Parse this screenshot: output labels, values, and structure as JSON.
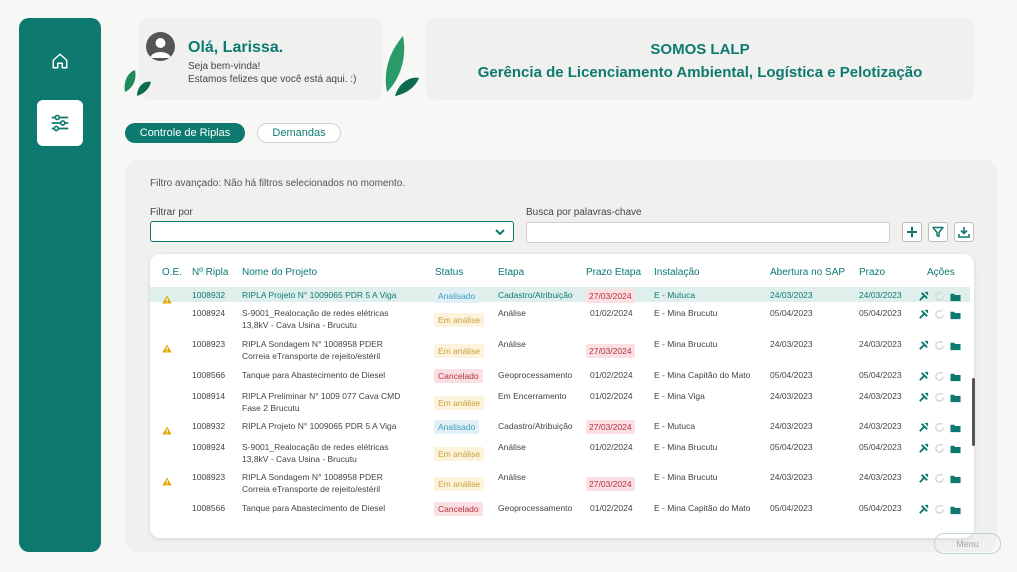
{
  "greeting": {
    "title": "Olá, Larissa.",
    "line1": "Seja bem-vinda!",
    "line2": "Estamos felizes que você está aqui. :)"
  },
  "banner": {
    "title": "SOMOS LALP",
    "subtitle": "Gerência de Licenciamento Ambiental, Logística e Pelotização"
  },
  "tabs": [
    "Controle de Riplas",
    "Demandas"
  ],
  "filter": {
    "info": "Filtro avançado: Não há filtros selecionados no momento.",
    "filter_label": "Filtrar por",
    "search_label": "Busca por palavras-chave",
    "filter_value": "",
    "search_value": ""
  },
  "table": {
    "headers": [
      "O.E.",
      "Nº Ripla",
      "Nome do Projeto",
      "Status",
      "Etapa",
      "Prazo Etapa",
      "Instalação",
      "Abertura no SAP",
      "Prazo",
      "Ações"
    ],
    "rows": [
      {
        "warn": true,
        "id": "1008932",
        "name1": "RIPLA Projeto N° 1009065 PDR 5 A Viga",
        "name2": "",
        "status": "Analisado",
        "etapa": "Cadastro/Atribuição",
        "prazo_etapa": "27/03/2024",
        "prazo_etapa_late": true,
        "instalacao": "E - Mutuca",
        "abertura": "24/03/2023",
        "prazo": "24/03/2023",
        "highlight": true
      },
      {
        "warn": false,
        "id": "1008924",
        "name1": "S-9001_Realocação de redes elétricas",
        "name2": "13,8kV - Cava Usina - Brucutu",
        "status": "Em análise",
        "etapa": "Análise",
        "prazo_etapa": "01/02/2024",
        "prazo_etapa_late": false,
        "instalacao": "E - Mina Brucutu",
        "abertura": "05/04/2023",
        "prazo": "05/04/2023",
        "highlight": false
      },
      {
        "warn": true,
        "id": "1008923",
        "name1": "RIPLA Sondagem N° 1008958 PDER",
        "name2": "Correia eTransporte de rejeito/estéril",
        "status": "Em análise",
        "etapa": "Análise",
        "prazo_etapa": "27/03/2024",
        "prazo_etapa_late": true,
        "instalacao": "E - Mina Brucutu",
        "abertura": "24/03/2023",
        "prazo": "24/03/2023",
        "highlight": false
      },
      {
        "warn": false,
        "id": "1008566",
        "name1": "Tanque para Abastecimento de Diesel",
        "name2": "",
        "status": "Cancelado",
        "etapa": "Geoprocessamento",
        "prazo_etapa": "01/02/2024",
        "prazo_etapa_late": false,
        "instalacao": "E - Mina Capitão do Mato",
        "abertura": "05/04/2023",
        "prazo": "05/04/2023",
        "highlight": false
      },
      {
        "warn": false,
        "id": "1008914",
        "name1": "RIPLA Preliminar N° 1009 077 Cava CMD",
        "name2": "Fase 2 Brucutu",
        "status": "Em análise",
        "etapa": "Em Encerramento",
        "prazo_etapa": "01/02/2024",
        "prazo_etapa_late": false,
        "instalacao": "E - Mina Viga",
        "abertura": "24/03/2023",
        "prazo": "24/03/2023",
        "highlight": false
      },
      {
        "warn": true,
        "id": "1008932",
        "name1": "RIPLA Projeto N° 1009065 PDR 5 A Viga",
        "name2": "",
        "status": "Analisado",
        "etapa": "Cadastro/Atribuição",
        "prazo_etapa": "27/03/2024",
        "prazo_etapa_late": true,
        "instalacao": "E - Mutuca",
        "abertura": "24/03/2023",
        "prazo": "24/03/2023",
        "highlight": false
      },
      {
        "warn": false,
        "id": "1008924",
        "name1": "S-9001_Realocação de redes elétricas",
        "name2": "13,8kV - Cava Usina - Brucutu",
        "status": "Em análise",
        "etapa": "Análise",
        "prazo_etapa": "01/02/2024",
        "prazo_etapa_late": false,
        "instalacao": "E - Mina Brucutu",
        "abertura": "05/04/2023",
        "prazo": "05/04/2023",
        "highlight": false
      },
      {
        "warn": true,
        "id": "1008923",
        "name1": "RIPLA Sondagem N° 1008958 PDER",
        "name2": "Correia eTransporte de rejeito/estéril",
        "status": "Em análise",
        "etapa": "Análise",
        "prazo_etapa": "27/03/2024",
        "prazo_etapa_late": true,
        "instalacao": "E - Mina Brucutu",
        "abertura": "24/03/2023",
        "prazo": "24/03/2023",
        "highlight": false
      },
      {
        "warn": false,
        "id": "1008566",
        "name1": "Tanque para Abastecimento de Diesel",
        "name2": "",
        "status": "Cancelado",
        "etapa": "Geoprocessamento",
        "prazo_etapa": "01/02/2024",
        "prazo_etapa_late": false,
        "instalacao": "E - Mina Capitão do Mato",
        "abertura": "05/04/2023",
        "prazo": "05/04/2023",
        "highlight": false
      }
    ]
  },
  "menu_label": "Menu",
  "colors": {
    "primary": "#0e7a6f",
    "analisado": "#3a9bbf",
    "em_analise": "#c9a13a",
    "cancelado": "#b33040",
    "warning": "#e0a800"
  },
  "icons": [
    "home-icon",
    "settings-sliders-icon",
    "user-avatar-icon",
    "leaf-icon",
    "chevron-down-icon",
    "plus-icon",
    "filter-icon",
    "download-icon",
    "warning-icon",
    "tools-icon",
    "refresh-icon",
    "folder-icon"
  ]
}
